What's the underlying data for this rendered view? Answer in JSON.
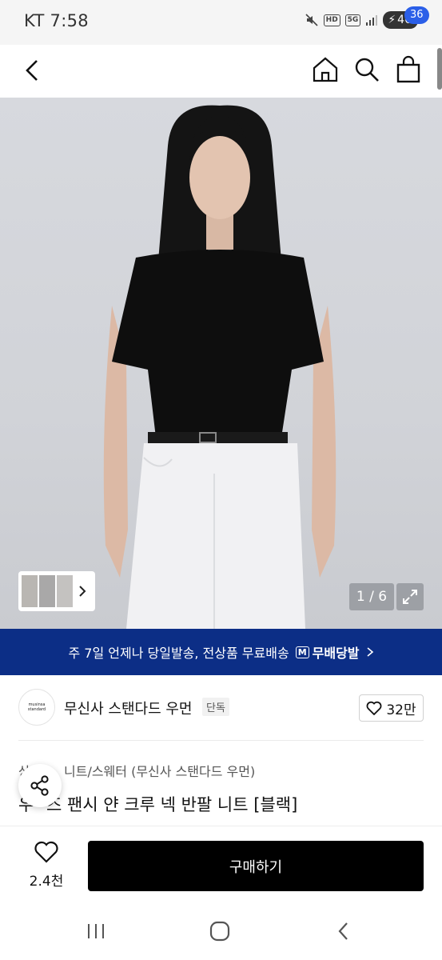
{
  "status_bar": {
    "carrier_time": "KT 7:58",
    "hd_label": "HD",
    "network_label": "5G",
    "battery": "46"
  },
  "nav": {
    "cart_count": "36"
  },
  "gallery": {
    "counter": "1 / 6"
  },
  "banner": {
    "text": "주 7일 언제나 당일발송, 전상품 무료배송",
    "logo_mark": "M",
    "logo_text": "무배당발"
  },
  "brand": {
    "logo_text": "musinsa standard",
    "name": "무신사 스탠다드 우먼",
    "badge": "단독",
    "likes": "32만"
  },
  "product": {
    "category_prefix": "상",
    "category": "니트/스웨터 (무신사 스탠다드 우먼)",
    "title_prefix": "우",
    "title": "즈 팬시 얀 크루 넥 반팔 니트 [블랙]"
  },
  "actions": {
    "wish_count": "2.4천",
    "buy_label": "구매하기"
  },
  "colors": {
    "banner_bg": "#0c2e86",
    "badge_bg": "#2b5fe8",
    "buy_bg": "#000000"
  }
}
